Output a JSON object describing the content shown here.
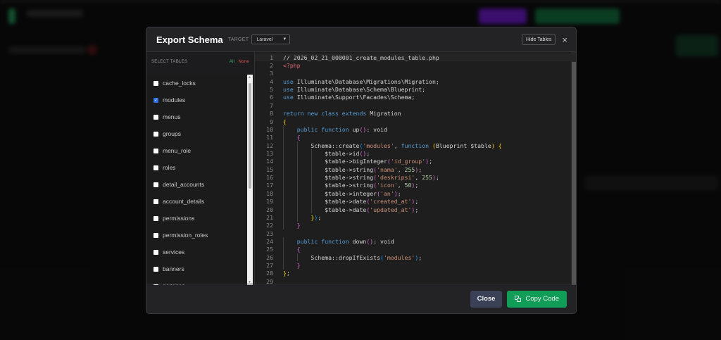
{
  "modal": {
    "title": "Export Schema",
    "target_label": "TARGET",
    "target_value": "Laravel",
    "hide_tables_label": "Hide Tables",
    "close_icon": "×"
  },
  "tables_panel": {
    "heading": "SELECT TABLES",
    "all_label": "All",
    "none_label": "None",
    "items": [
      {
        "name": "cache_locks",
        "checked": false
      },
      {
        "name": "modules",
        "checked": true
      },
      {
        "name": "menus",
        "checked": false
      },
      {
        "name": "groups",
        "checked": false
      },
      {
        "name": "menu_role",
        "checked": false
      },
      {
        "name": "roles",
        "checked": false
      },
      {
        "name": "detail_accounts",
        "checked": false
      },
      {
        "name": "account_details",
        "checked": false
      },
      {
        "name": "permissions",
        "checked": false
      },
      {
        "name": "permission_roles",
        "checked": false
      },
      {
        "name": "services",
        "checked": false
      },
      {
        "name": "banners",
        "checked": false
      },
      {
        "name": "galleries",
        "checked": false
      }
    ]
  },
  "code": {
    "lines": [
      [
        [
          "c",
          "// 2026_02_21_000001_create_modules_table.php"
        ]
      ],
      [
        [
          "r",
          "<?php"
        ]
      ],
      [],
      [
        [
          "k",
          "use "
        ],
        [
          "t",
          "Illuminate\\Database\\Migrations\\Migration;"
        ]
      ],
      [
        [
          "k",
          "use "
        ],
        [
          "t",
          "Illuminate\\Database\\Schema\\Blueprint;"
        ]
      ],
      [
        [
          "k",
          "use "
        ],
        [
          "t",
          "Illuminate\\Support\\Facades\\Schema;"
        ]
      ],
      [],
      [
        [
          "k",
          "return new class extends "
        ],
        [
          "t",
          "Migration"
        ]
      ],
      [
        [
          "b1",
          "{"
        ]
      ],
      [
        [
          "t",
          "    "
        ],
        [
          "k",
          "public function "
        ],
        [
          "t",
          "up"
        ],
        [
          "b2",
          "()"
        ],
        [
          "t",
          ": void"
        ]
      ],
      [
        [
          "t",
          "    "
        ],
        [
          "b2",
          "{"
        ]
      ],
      [
        [
          "t",
          "        Schema::create"
        ],
        [
          "b3",
          "("
        ],
        [
          "s",
          "'modules'"
        ],
        [
          "t",
          ", "
        ],
        [
          "k",
          "function "
        ],
        [
          "b1",
          "("
        ],
        [
          "t",
          "Blueprint $table"
        ],
        [
          "b1",
          ")"
        ],
        [
          "t",
          " "
        ],
        [
          "b1",
          "{"
        ]
      ],
      [
        [
          "t",
          "            $table->id"
        ],
        [
          "b2",
          "()"
        ],
        [
          "t",
          ";"
        ]
      ],
      [
        [
          "t",
          "            $table->bigInteger"
        ],
        [
          "b2",
          "("
        ],
        [
          "s",
          "'id_group'"
        ],
        [
          "b2",
          ")"
        ],
        [
          "t",
          ";"
        ]
      ],
      [
        [
          "t",
          "            $table->string"
        ],
        [
          "b2",
          "("
        ],
        [
          "s",
          "'nama'"
        ],
        [
          "t",
          ", "
        ],
        [
          "n",
          "255"
        ],
        [
          "b2",
          ")"
        ],
        [
          "t",
          ";"
        ]
      ],
      [
        [
          "t",
          "            $table->string"
        ],
        [
          "b2",
          "("
        ],
        [
          "s",
          "'deskripsi'"
        ],
        [
          "t",
          ", "
        ],
        [
          "n",
          "255"
        ],
        [
          "b2",
          ")"
        ],
        [
          "t",
          ";"
        ]
      ],
      [
        [
          "t",
          "            $table->string"
        ],
        [
          "b2",
          "("
        ],
        [
          "s",
          "'icon'"
        ],
        [
          "t",
          ", "
        ],
        [
          "n",
          "50"
        ],
        [
          "b2",
          ")"
        ],
        [
          "t",
          ";"
        ]
      ],
      [
        [
          "t",
          "            $table->integer"
        ],
        [
          "b2",
          "("
        ],
        [
          "s",
          "'an'"
        ],
        [
          "b2",
          ")"
        ],
        [
          "t",
          ";"
        ]
      ],
      [
        [
          "t",
          "            $table->date"
        ],
        [
          "b2",
          "("
        ],
        [
          "s",
          "'created_at'"
        ],
        [
          "b2",
          ")"
        ],
        [
          "t",
          ";"
        ]
      ],
      [
        [
          "t",
          "            $table->date"
        ],
        [
          "b2",
          "("
        ],
        [
          "s",
          "'updated_at'"
        ],
        [
          "b2",
          ")"
        ],
        [
          "t",
          ";"
        ]
      ],
      [
        [
          "t",
          "        "
        ],
        [
          "b1",
          "}"
        ],
        [
          "b3",
          ")"
        ],
        [
          "t",
          ";"
        ]
      ],
      [
        [
          "t",
          "    "
        ],
        [
          "b2",
          "}"
        ]
      ],
      [],
      [
        [
          "t",
          "    "
        ],
        [
          "k",
          "public function "
        ],
        [
          "t",
          "down"
        ],
        [
          "b2",
          "()"
        ],
        [
          "t",
          ": void"
        ]
      ],
      [
        [
          "t",
          "    "
        ],
        [
          "b2",
          "{"
        ]
      ],
      [
        [
          "t",
          "        Schema::dropIfExists"
        ],
        [
          "b3",
          "("
        ],
        [
          "s",
          "'modules'"
        ],
        [
          "b3",
          ")"
        ],
        [
          "t",
          ";"
        ]
      ],
      [
        [
          "t",
          "    "
        ],
        [
          "b2",
          "}"
        ]
      ],
      [
        [
          "b1",
          "}"
        ],
        [
          "t",
          ";"
        ]
      ],
      []
    ]
  },
  "footer": {
    "close_label": "Close",
    "copy_label": "Copy Code"
  }
}
